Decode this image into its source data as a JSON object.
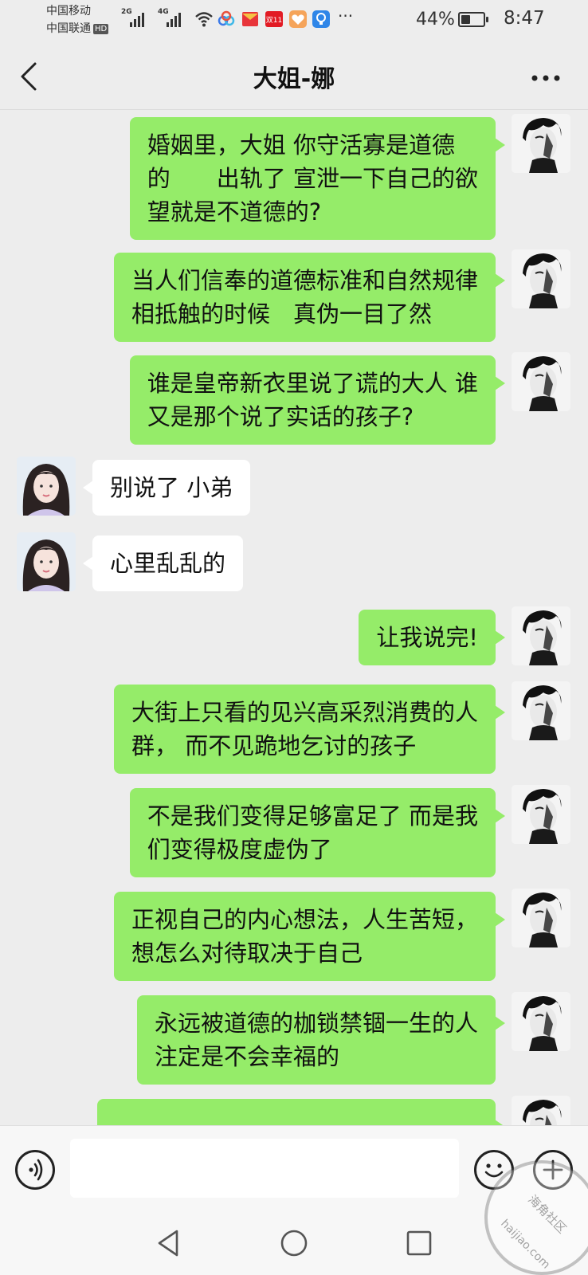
{
  "status_bar": {
    "carrier_1": "中国移动",
    "carrier_2": "中国联通",
    "hd_badge": "HD",
    "net_1": "2G",
    "net_2": "4G",
    "battery_percent": "44%",
    "battery_level": 0.44,
    "time": "8:47",
    "overflow": "···",
    "shopping_badge": "双11",
    "icons": [
      "signal-icon",
      "wifi-icon",
      "cloud-app-icon",
      "red-envelope-icon",
      "shopping-badge-icon",
      "health-app-icon",
      "bulb-app-icon",
      "more-notifications-icon",
      "battery-icon"
    ]
  },
  "header": {
    "title": "大姐-娜",
    "back_icon": "chevron-left-icon",
    "more_icon": "more-dots-icon"
  },
  "messages": [
    {
      "from": "me",
      "text": "婚姻里，大姐 你守活寡是道德\n的　　出轨了 宣泄一下自己的欲\n望就是不道德的?"
    },
    {
      "from": "me",
      "text": "当人们信奉的道德标准和自然规律\n相抵触的时候　真伪一目了然"
    },
    {
      "from": "me",
      "text": "谁是皇帝新衣里说了谎的大人 谁\n又是那个说了实话的孩子?"
    },
    {
      "from": "them",
      "text": "别说了 小弟"
    },
    {
      "from": "them",
      "text": "心里乱乱的"
    },
    {
      "from": "me",
      "text": "让我说完!"
    },
    {
      "from": "me",
      "text": "大街上只看的见兴高采烈消费的人\n群， 而不见跪地乞讨的孩子"
    },
    {
      "from": "me",
      "text": "不是我们变得足够富足了 而是我\n们变得极度虚伪了"
    },
    {
      "from": "me",
      "text": "正视自己的内心想法，人生苦短，\n想怎么对待取决于自己"
    },
    {
      "from": "me",
      "text": "永远被道德的枷锁禁锢一生的人\n注定是不会幸福的"
    },
    {
      "from": "me",
      "text": ""
    }
  ],
  "input_bar": {
    "value": "",
    "voice_icon": "voice-icon",
    "emoji_icon": "emoji-icon",
    "plus_icon": "plus-icon"
  },
  "nav_bar": {
    "icons": [
      "nav-back-icon",
      "nav-home-icon",
      "nav-recents-icon"
    ]
  },
  "watermark": {
    "text_cn": "海角社区",
    "text_url": "haijiao.com"
  },
  "colors": {
    "background": "#ededed",
    "my_bubble": "#95ec69",
    "their_bubble": "#ffffff"
  }
}
